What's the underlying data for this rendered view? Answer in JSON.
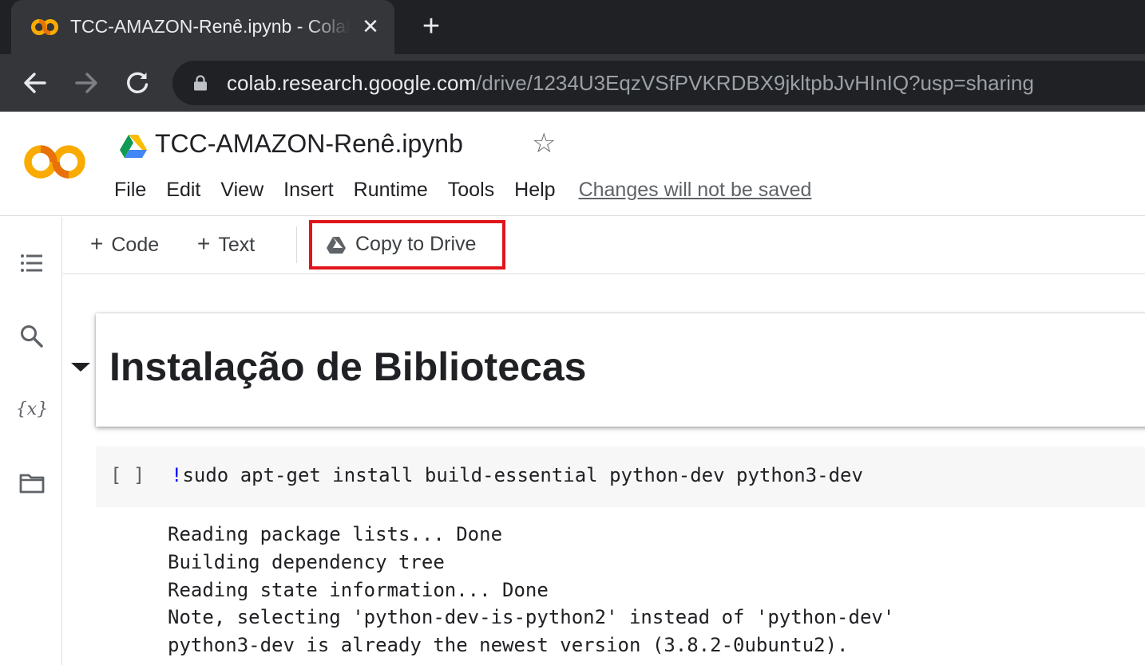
{
  "browser": {
    "tab_title": "TCC-AMAZON-Renê.ipynb - Colab",
    "tab_close": "✕",
    "new_tab": "+",
    "url_host": "colab.research.google.com",
    "url_path": "/drive/1234U3EqzVSfPVKRDBX9jkltpbJvHInIQ?usp=sharing"
  },
  "header": {
    "doc_title": "TCC-AMAZON-Renê.ipynb",
    "star": "☆",
    "menu": [
      "File",
      "Edit",
      "View",
      "Insert",
      "Runtime",
      "Tools",
      "Help"
    ],
    "unsaved_notice": "Changes will not be saved"
  },
  "toolbar": {
    "code_label": "Code",
    "text_label": "Text",
    "plus": "+",
    "copy_to_drive_label": "Copy to Drive",
    "highlight_color": "#e0151c"
  },
  "sidebar": {
    "icons": [
      "table-of-contents-icon",
      "search-icon",
      "variables-icon",
      "files-icon"
    ]
  },
  "notebook": {
    "section_heading": "Instalação de Bibliotecas",
    "code_cell": {
      "run_indicator": "[ ]",
      "bang": "!",
      "command": "sudo apt-get install build-essential python-dev python3-dev"
    },
    "output_lines": [
      "Reading package lists... Done",
      "Building dependency tree",
      "Reading state information... Done",
      "Note, selecting 'python-dev-is-python2' instead of 'python-dev'",
      "python3-dev is already the newest version (3.8.2-0ubuntu2)."
    ]
  },
  "colors": {
    "chrome_dark": "#202124",
    "chrome_tab": "#35363a",
    "colab_orange": "#f9ab00",
    "colab_dark_orange": "#e8710a"
  }
}
